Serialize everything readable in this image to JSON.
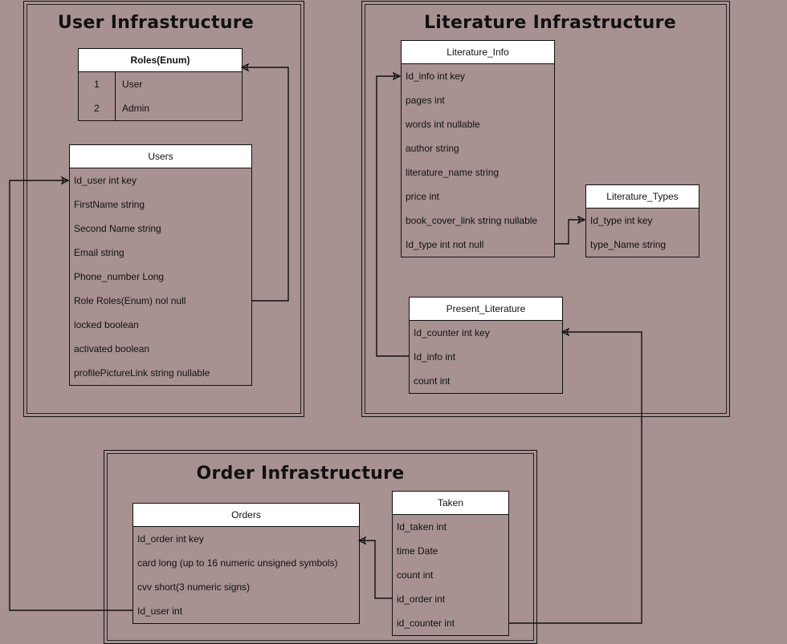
{
  "groups": {
    "user": {
      "title": "User Infrastructure"
    },
    "literature": {
      "title": "Literature Infrastructure"
    },
    "order": {
      "title": "Order Infrastructure"
    }
  },
  "tables": {
    "roles": {
      "title": "Roles(Enum)",
      "rows": [
        {
          "key": "1",
          "value": "User"
        },
        {
          "key": "2",
          "value": "Admin"
        }
      ]
    },
    "users": {
      "title": "Users",
      "rows": [
        "Id_user int key",
        "FirstName string",
        "Second Name string",
        "Email string",
        "Phone_number  Long",
        "Role Roles(Enum) nol null",
        "locked boolean",
        "activated boolean",
        "profilePictureLink string nullable"
      ]
    },
    "literature_info": {
      "title": "Literature_Info",
      "rows": [
        "Id_info int key",
        "pages int",
        "words int nullable",
        "author string",
        "literature_name string",
        "price int",
        "book_cover_link string nullable",
        "Id_type int not null"
      ]
    },
    "literature_types": {
      "title": "Literature_Types",
      "rows": [
        "Id_type int key",
        "type_Name string"
      ]
    },
    "present_literature": {
      "title": "Present_Literature",
      "rows": [
        "Id_counter int key",
        "Id_info int",
        "count int"
      ]
    },
    "orders": {
      "title": "Orders",
      "rows": [
        "Id_order int key",
        "card long (up to 16 numeric unsigned symbols)",
        "cvv short(3 numeric signs)",
        "Id_user int"
      ]
    },
    "taken": {
      "title": "Taken",
      "rows": [
        "Id_taken int",
        "time Date",
        "count int",
        "id_order int",
        "id_counter int"
      ]
    }
  },
  "colors": {
    "background": "#a89191",
    "header": "#ffffff",
    "line": "#111111"
  }
}
